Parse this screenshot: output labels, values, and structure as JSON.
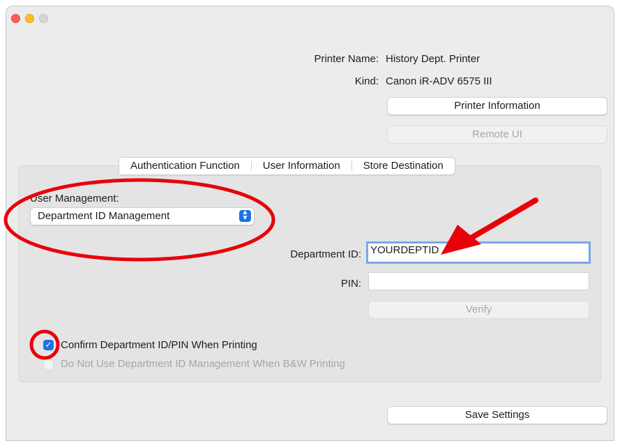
{
  "printer": {
    "name_label": "Printer Name:",
    "name_value": "History Dept. Printer",
    "kind_label": "Kind:",
    "kind_value": "Canon iR-ADV 6575 III"
  },
  "buttons": {
    "printer_information": "Printer Information",
    "remote_ui": "Remote UI",
    "verify": "Verify",
    "save_settings": "Save Settings"
  },
  "tabs": [
    {
      "label": "Authentication Function",
      "selected": true
    },
    {
      "label": "User Information",
      "selected": false
    },
    {
      "label": "Store Destination",
      "selected": false
    }
  ],
  "auth": {
    "user_management_label": "User Management:",
    "user_management_value": "Department ID Management",
    "department_id_label": "Department ID:",
    "department_id_value": "YOURDEPTID",
    "pin_label": "PIN:",
    "pin_value": "",
    "confirm_checkbox": {
      "label": "Confirm Department ID/PIN When Printing",
      "checked": true
    },
    "bw_checkbox": {
      "label": "Do Not Use Department ID Management When B&W Printing",
      "checked": false,
      "enabled": false
    }
  },
  "colors": {
    "accent": "#1a73e8",
    "annotation_red": "#e8000b"
  }
}
